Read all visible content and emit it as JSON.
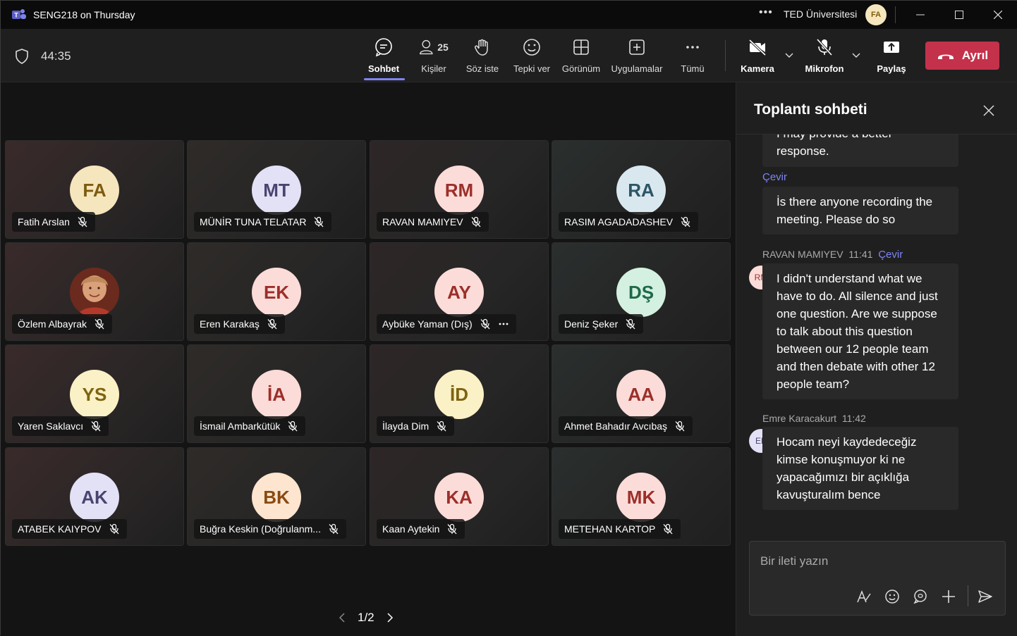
{
  "window": {
    "title": "SENG218 on Thursday",
    "more": "•••",
    "org": "TED Üniversitesi",
    "org_avatar": "FA"
  },
  "toolbar": {
    "timer": "44:35",
    "items": [
      {
        "label": "Sohbet",
        "icon": "chat-icon"
      },
      {
        "label": "Kişiler",
        "icon": "people-icon",
        "count": "25"
      },
      {
        "label": "Söz iste",
        "icon": "raise-hand-icon"
      },
      {
        "label": "Tepki ver",
        "icon": "react-icon"
      },
      {
        "label": "Görünüm",
        "icon": "view-icon"
      },
      {
        "label": "Uygulamalar",
        "icon": "apps-icon"
      },
      {
        "label": "Tümü",
        "icon": "more-icon"
      }
    ],
    "camera": "Kamera",
    "mic": "Mikrofon",
    "share": "Paylaş",
    "leave": "Ayrıl"
  },
  "participants": [
    {
      "initials": "FA",
      "name": "Fatih Arslan",
      "bg": "#f6e6bd",
      "fg": "#7d5b0f"
    },
    {
      "initials": "MT",
      "name": "MÜNİR TUNA TELATAR",
      "bg": "#e3e1f6",
      "fg": "#4a4470"
    },
    {
      "initials": "RM",
      "name": "RAVAN MAMIYEV",
      "bg": "#fcdcd8",
      "fg": "#9c2f2a"
    },
    {
      "initials": "RA",
      "name": "RASIM AGADADASHEV",
      "bg": "#d9e8ef",
      "fg": "#2c5566"
    },
    {
      "initials": "",
      "name": "Özlem Albayrak",
      "bg": "#5a2a20",
      "fg": "#fff"
    },
    {
      "initials": "EK",
      "name": "Eren Karakaş",
      "bg": "#fcdcd8",
      "fg": "#9c2f2a"
    },
    {
      "initials": "AY",
      "name": "Aybüke Yaman (Dış)",
      "bg": "#fcdcd8",
      "fg": "#9c2f2a"
    },
    {
      "initials": "DŞ",
      "name": "Deniz Şeker",
      "bg": "#d4f0e1",
      "fg": "#1f6a47"
    },
    {
      "initials": "YS",
      "name": "Yaren Saklavcı",
      "bg": "#fbf1c6",
      "fg": "#7d6410"
    },
    {
      "initials": "İA",
      "name": "İsmail Ambarkütük",
      "bg": "#fcdcd8",
      "fg": "#9c2f2a"
    },
    {
      "initials": "İD",
      "name": "İlayda Dim",
      "bg": "#fbf1c6",
      "fg": "#7d6410"
    },
    {
      "initials": "AA",
      "name": "Ahmet Bahadır Avcıbaş",
      "bg": "#fcdcd8",
      "fg": "#9c2f2a"
    },
    {
      "initials": "AK",
      "name": "ATABEK KAIYPOV",
      "bg": "#e3e1f6",
      "fg": "#4a4470"
    },
    {
      "initials": "BK",
      "name": "Buğra Keskin (Doğrulanm...",
      "bg": "#fde5cf",
      "fg": "#8a4a12"
    },
    {
      "initials": "KA",
      "name": "Kaan Aytekin",
      "bg": "#fcdcd8",
      "fg": "#9c2f2a"
    },
    {
      "initials": "MK",
      "name": "METEHAN KARTOP",
      "bg": "#fcdcd8",
      "fg": "#9c2f2a"
    }
  ],
  "pager": {
    "text": "1/2"
  },
  "chat": {
    "title": "Toplantı sohbeti",
    "partial_text_top": "I may provide a better",
    "partial_text_bottom": "response.",
    "translate_label": "Çevir",
    "msg1": "İs there anyone recording the meeting. Please do so",
    "msg2_author": "RAVAN MAMIYEV",
    "msg2_time": "11:41",
    "msg2_avatar": "RM",
    "msg2": "I didn't understand what we have to do. All silence and just one question. Are we suppose to talk about this question between our 12 people team and then debate with other 12 people team?",
    "msg3_author": "Emre Karacakurt",
    "msg3_time": "11:42",
    "msg3_avatar": "EK",
    "msg3": "Hocam neyi kaydedeceğiz kimse konuşmuyor ki ne yapacağımızı bir açıklığa kavuşturalım bence",
    "composer_placeholder": "Bir ileti yazın"
  },
  "colors": {
    "accent": "#7f85f5",
    "leave": "#c4314b"
  }
}
